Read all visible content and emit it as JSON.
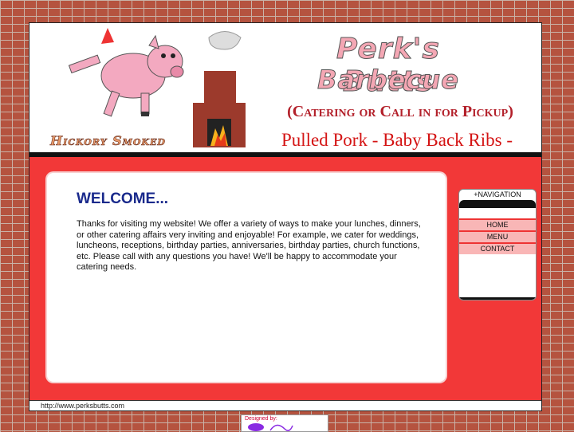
{
  "header": {
    "title_line1": "Perk's Butts",
    "title_line2": "Barbecue",
    "catering": "(Catering or Call in for Pickup)",
    "menu_line": "Pulled Pork - Baby Back Ribs - Poultry",
    "hickory": "Hickory Smoked"
  },
  "welcome": {
    "title": "WELCOME...",
    "body": "Thanks for visiting my website! We offer a variety of ways to make your lunches, dinners, or other catering affairs very inviting and enjoyable! For example, we cater for weddings, luncheons, receptions, birthday parties, anniversaries, birthday parties, church functions, etc. Please call with any questions you have! We'll be happy to accommodate your catering needs."
  },
  "nav": {
    "title": "+NAVIGATION",
    "items": [
      {
        "label": "HOME"
      },
      {
        "label": "MENU"
      },
      {
        "label": "CONTACT"
      }
    ]
  },
  "footer": {
    "url": "http://www.perksbutts.com"
  },
  "designer": {
    "label": "Designed by:"
  },
  "colors": {
    "content_red": "#f23838",
    "title_pink": "#f4a7b4",
    "catering_red": "#b3202a",
    "welcome_blue": "#1a2a8c",
    "nav_pink": "#f9b6b6"
  }
}
